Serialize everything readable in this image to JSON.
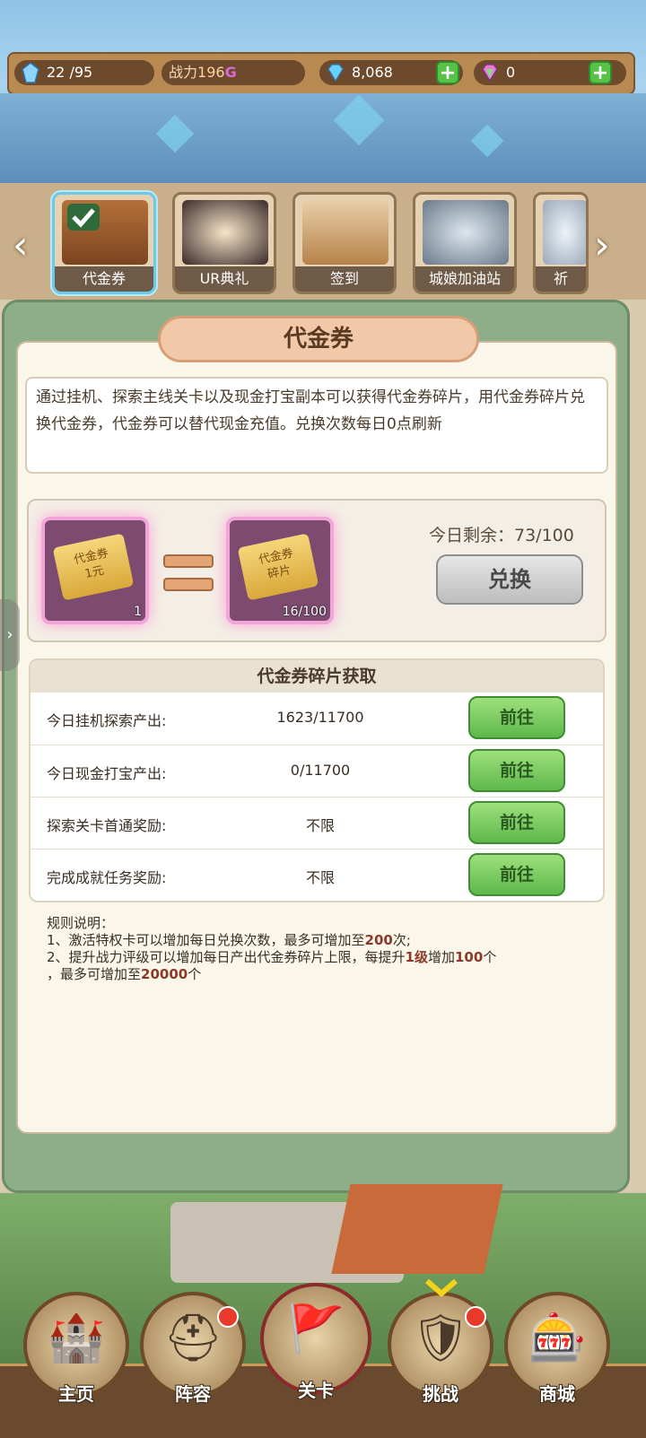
{
  "topbar": {
    "stamina": "22 /95",
    "power_label": "战力",
    "power_value": "196",
    "power_unit": "G",
    "gems": "8,068",
    "premium_gems": "0",
    "plus_symbol": "+"
  },
  "tabs": [
    {
      "label": "代金券",
      "active": true
    },
    {
      "label": "UR典礼",
      "active": false
    },
    {
      "label": "签到",
      "active": false
    },
    {
      "label": "城娘加油站",
      "active": false
    },
    {
      "label": "祈",
      "active": false
    }
  ],
  "nav_arrows": {
    "left": "‹",
    "right": "›"
  },
  "panel": {
    "title": "代金券",
    "description": "通过挂机、探索主线关卡以及现金打宝副本可以获得代金券碎片，用代金券碎片兑换代金券，代金券可以替代现金充值。兑换次数每日0点刷新"
  },
  "exchange": {
    "voucher_text": "代金券\n1元",
    "voucher_count": "1",
    "fragment_text": "代金券\n碎片",
    "fragment_count": "16/100",
    "remaining_label": "今日剩余：73/100",
    "button_label": "兑换"
  },
  "sources": {
    "header": "代金券碎片获取",
    "rows": [
      {
        "name": "今日挂机探索产出:",
        "value": "1623/11700",
        "button": "前往"
      },
      {
        "name": "今日现金打宝产出:",
        "value": "0/11700",
        "button": "前往"
      },
      {
        "name": "探索关卡首通奖励:",
        "value": "不限",
        "button": "前往"
      },
      {
        "name": "完成成就任务奖励:",
        "value": "不限",
        "button": "前往"
      }
    ]
  },
  "rules": {
    "title": "规则说明：",
    "line1_a": "1、激活特权卡可以增加每日兑换次数，最多可增加至",
    "line1_b": "200",
    "line1_c": "次;",
    "line2_a": "2、提升战力评级可以增加每日产出代金券碎片上限，每提升",
    "line2_b": "1级",
    "line2_c": "增加",
    "line2_d": "100",
    "line2_e": "个",
    "line3_a": "，最多可增加至",
    "line3_b": "20000",
    "line3_c": "个"
  },
  "bottom_nav": [
    {
      "label": "主页",
      "icon": "castle-icon"
    },
    {
      "label": "阵容",
      "icon": "helmet-icon"
    },
    {
      "label": "关卡",
      "icon": "battle-flag-icon"
    },
    {
      "label": "挑战",
      "icon": "shield-swords-icon"
    },
    {
      "label": "商城",
      "icon": "gacha-machine-icon"
    }
  ],
  "colors": {
    "panel_green": "#8eae89",
    "go_button_green": "#5eb84a",
    "active_tab": "#6cc9e8",
    "highlight_text": "#8b3a2a"
  }
}
